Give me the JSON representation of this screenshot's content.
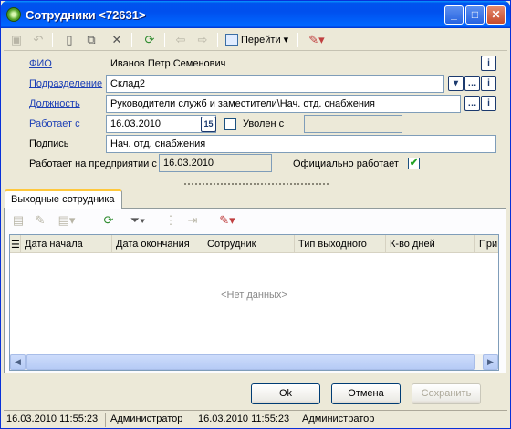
{
  "window": {
    "title": "Сотрудники <72631>"
  },
  "toolbar": {
    "go_label": "Перейти"
  },
  "form": {
    "fio": {
      "label": "ФИО",
      "value": "Иванов Петр Семенович"
    },
    "dept": {
      "label": "Подразделение",
      "value": "Склад2"
    },
    "position": {
      "label": "Должность",
      "value": "Руководители служб и заместители\\Нач. отд. снабжения"
    },
    "works_from": {
      "label": "Работает с",
      "value": "16.03.2010",
      "cal_label": "15"
    },
    "fired": {
      "label": "Уволен с",
      "value": ""
    },
    "signature": {
      "label": "Подпись",
      "value": "Нач. отд. снабжения"
    },
    "works_at_company": {
      "label": "Работает на предприятии с",
      "value": "16.03.2010"
    },
    "official": {
      "label": "Официально работает",
      "checked": "✔"
    }
  },
  "tab": {
    "label": "Выходные сотрудника"
  },
  "grid": {
    "columns": [
      "Дата начала",
      "Дата окончания",
      "Сотрудник",
      "Тип выходного",
      "К-во дней",
      "При"
    ],
    "empty_text": "<Нет данных>"
  },
  "buttons": {
    "ok": "Ok",
    "cancel": "Отмена",
    "save": "Сохранить"
  },
  "status": {
    "created_at": "16.03.2010 11:55:23",
    "created_by": "Администратор",
    "modified_at": "16.03.2010 11:55:23",
    "modified_by": "Администратор"
  }
}
